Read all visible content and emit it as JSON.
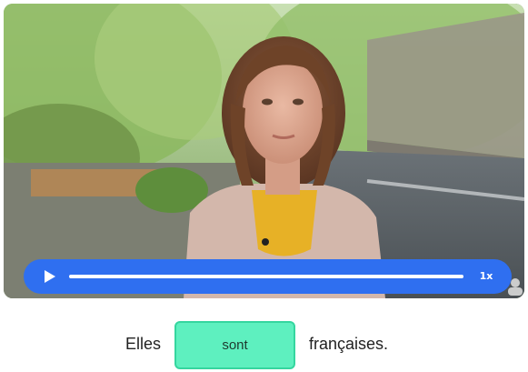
{
  "video": {
    "speed_label": "1x",
    "playing": false
  },
  "sentence": {
    "before": "Elles",
    "answer": "sont",
    "after": "françaises."
  },
  "colors": {
    "controls_bg": "#2f6ff0",
    "answer_bg": "#5ef0bf",
    "answer_border": "#35d69f"
  },
  "icons": {
    "play": "play-icon",
    "corner": "user-icon"
  }
}
